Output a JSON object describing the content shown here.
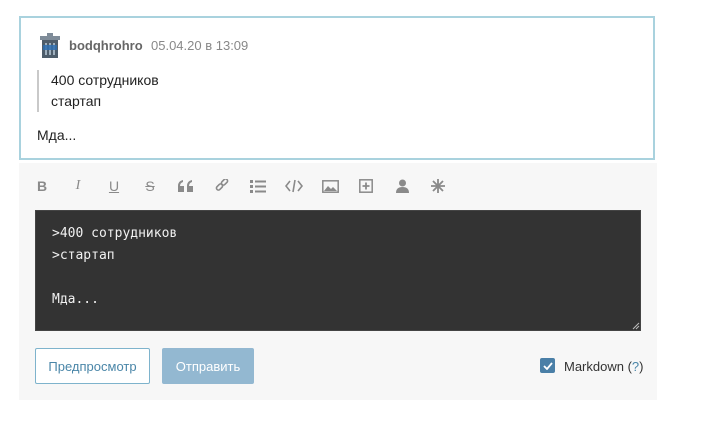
{
  "comment": {
    "author": "bodqhrohro",
    "timestamp": "05.04.20 в 13:09",
    "quote_lines": [
      "400 сотрудников",
      "стартап"
    ],
    "text": "Мда..."
  },
  "editor": {
    "toolbar": [
      "bold-icon",
      "italic-icon",
      "underline-icon",
      "strikethrough-icon",
      "quote-icon",
      "link-icon",
      "list-icon",
      "code-icon",
      "image-icon",
      "spoiler-icon",
      "user-icon",
      "asterisk-icon"
    ],
    "textarea_value": ">400 сотрудников\n>стартап\n\nМда...",
    "preview_label": "Предпросмотр",
    "send_label": "Отправить",
    "markdown_label": "Markdown",
    "markdown_checked": true,
    "markdown_help": "?"
  }
}
